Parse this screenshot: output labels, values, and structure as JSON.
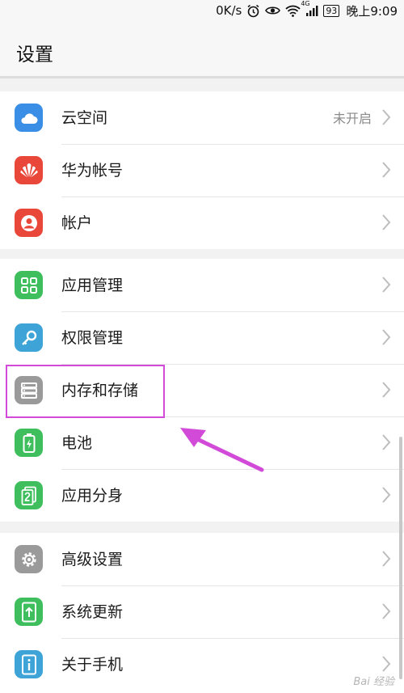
{
  "status_bar": {
    "speed": "0K/s",
    "network": "4G",
    "battery": "93",
    "time": "晚上9:09"
  },
  "header": {
    "title": "设置"
  },
  "groups": [
    {
      "items": [
        {
          "label": "云空间",
          "value": "未开启",
          "icon": "cloud-icon",
          "color": "#3a8ee6"
        },
        {
          "label": "华为帐号",
          "icon": "huawei-logo-icon",
          "color": "#e8473a"
        },
        {
          "label": "帐户",
          "icon": "account-icon",
          "color": "#e8473a"
        }
      ]
    },
    {
      "items": [
        {
          "label": "应用管理",
          "icon": "apps-grid-icon",
          "color": "#3fbe5e"
        },
        {
          "label": "权限管理",
          "icon": "key-icon",
          "color": "#3ea4d8"
        },
        {
          "label": "内存和存储",
          "icon": "storage-icon",
          "color": "#9a9a9a"
        },
        {
          "label": "电池",
          "icon": "battery-icon",
          "color": "#3fbe5e"
        },
        {
          "label": "应用分身",
          "icon": "app-twin-icon",
          "color": "#3fbe5e"
        }
      ]
    },
    {
      "items": [
        {
          "label": "高级设置",
          "icon": "gear-icon",
          "color": "#9a9a9a"
        },
        {
          "label": "系统更新",
          "icon": "system-update-icon",
          "color": "#3fbe5e"
        },
        {
          "label": "关于手机",
          "icon": "phone-info-icon",
          "color": "#3ea4d8"
        }
      ]
    }
  ],
  "annotation": {
    "highlight_color": "#d24bd8"
  },
  "watermark": "Bai 经验"
}
